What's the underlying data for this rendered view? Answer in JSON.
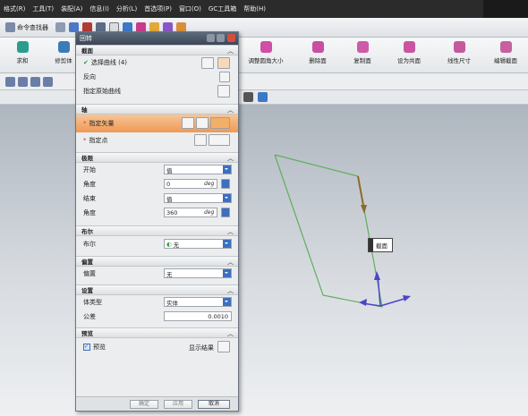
{
  "menubar": {
    "items": [
      "格式(R)",
      "工具(T)",
      "装配(A)",
      "信息(I)",
      "分析(L)",
      "首选项(P)",
      "窗口(O)",
      "GC工具箱",
      "帮助(H)"
    ]
  },
  "toolbar1": {
    "command_finder": "命令查找器"
  },
  "ribbon": {
    "left": [
      {
        "label": "求和"
      },
      {
        "label": "修剪体"
      }
    ],
    "right": [
      {
        "label": "调整圆角大小"
      },
      {
        "label": "删除面"
      },
      {
        "label": "复制面"
      },
      {
        "label": "设为共面"
      },
      {
        "label": "线性尺寸"
      },
      {
        "label": "编辑截面"
      }
    ]
  },
  "dialog": {
    "title": "回转",
    "sections": {
      "section": {
        "header": "截面",
        "select_curve": "选择曲线 (4)",
        "reverse": "反向",
        "specify_origin_curve": "指定原始曲线"
      },
      "axis": {
        "header": "轴",
        "specify_vector": "指定矢量",
        "specify_point": "指定点"
      },
      "limits": {
        "header": "极限",
        "start_label": "开始",
        "start_value": "值",
        "angle1_label": "角度",
        "angle1_value": "0",
        "angle1_unit": "deg",
        "end_label": "结束",
        "end_value": "值",
        "angle2_label": "角度",
        "angle2_value": "360",
        "angle2_unit": "deg"
      },
      "boolean": {
        "header": "布尔",
        "label": "布尔",
        "value": "无"
      },
      "offset": {
        "header": "偏置",
        "label": "偏置",
        "value": "无"
      },
      "settings": {
        "header": "设置",
        "body_type_label": "体类型",
        "body_type_value": "实体",
        "tolerance_label": "公差",
        "tolerance_value": "0.0010"
      },
      "preview": {
        "header": "预览",
        "preview_label": "预览",
        "show_result": "显示结果"
      }
    },
    "buttons": {
      "ok": "确定",
      "apply": "应用",
      "cancel": "取消"
    }
  },
  "viewport": {
    "section_label": "截面"
  },
  "colors": {
    "curve": "#5fae5f",
    "vector": "#4b46c6",
    "arrow_brown": "#8a6b2a",
    "highlight": "#ee9955"
  }
}
